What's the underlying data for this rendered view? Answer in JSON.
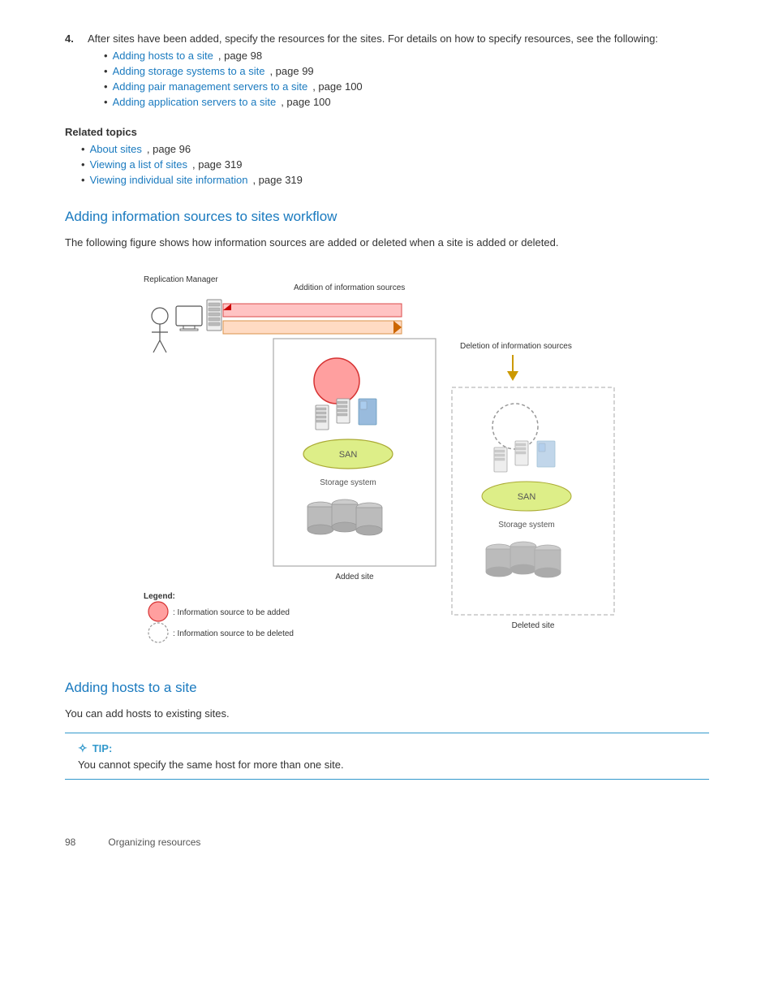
{
  "intro": {
    "step_number": "4.",
    "step_text": "After sites have been added, specify the resources for the sites. For details on how to specify resources, see the following:",
    "bullets": [
      {
        "link": "Adding hosts to a site",
        "suffix": ", page 98"
      },
      {
        "link": "Adding storage systems to a site",
        "suffix": ", page 99"
      },
      {
        "link": "Adding pair management servers to a site",
        "suffix": ", page 100"
      },
      {
        "link": "Adding application servers to a site",
        "suffix": ", page 100"
      }
    ]
  },
  "related_topics": {
    "title": "Related topics",
    "items": [
      {
        "link": "About sites",
        "suffix": ", page 96"
      },
      {
        "link": "Viewing a list of sites",
        "suffix": ", page 319"
      },
      {
        "link": "Viewing individual site information",
        "suffix": ", page 319"
      }
    ]
  },
  "section1": {
    "heading": "Adding information sources to sites workflow",
    "body": "The following figure shows how information sources are added or deleted when a site is added or deleted."
  },
  "section2": {
    "heading": "Adding hosts to a site",
    "body": "You can add hosts to existing sites."
  },
  "tip": {
    "label": "TIP:",
    "text": "You cannot specify the same host for more than one site."
  },
  "footer": {
    "page_number": "98",
    "section_title": "Organizing resources"
  },
  "diagram": {
    "replication_manager": "Replication Manager",
    "addition_label": "Addition of information sources",
    "deletion_label": "Deletion of information sources",
    "added_site": "Added site",
    "deleted_site": "Deleted site",
    "storage_system1": "Storage system",
    "storage_system2": "Storage system",
    "san1": "SAN",
    "san2": "SAN",
    "legend_title": "Legend:",
    "legend_add": ": Information source to be added",
    "legend_delete": ": Information source to be deleted"
  }
}
